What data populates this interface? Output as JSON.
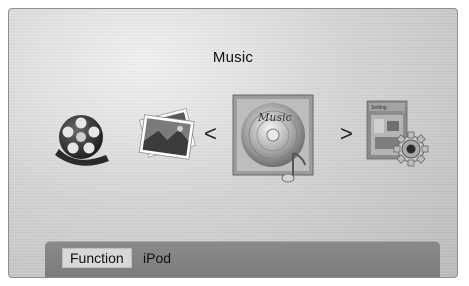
{
  "menu": {
    "title": "Music"
  },
  "carousel": {
    "items": [
      {
        "name": "Videos",
        "icon": "film-reel-icon"
      },
      {
        "name": "Photos",
        "icon": "photo-stack-icon"
      },
      {
        "name": "Music",
        "icon": "music-disc-icon",
        "cover_text": "Music",
        "selected": true
      },
      {
        "name": "Setting",
        "icon": "settings-gear-icon",
        "cover_text": "Setting"
      }
    ],
    "prev_arrow": "<",
    "next_arrow": ">"
  },
  "function_bar": {
    "button_label": "Function",
    "device_label": "iPod"
  }
}
